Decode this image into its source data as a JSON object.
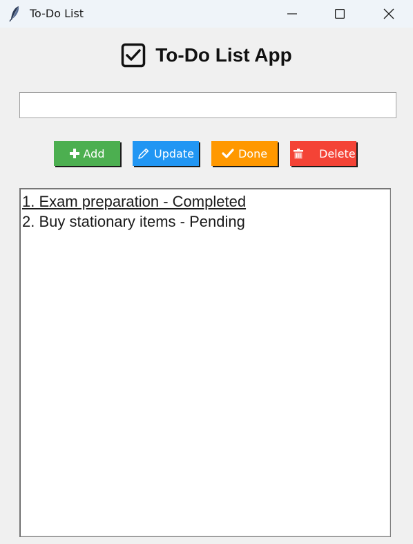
{
  "window": {
    "title": "To-Do List",
    "icon": "feather-icon",
    "controls": [
      "minimize-icon",
      "maximize-icon",
      "close-icon"
    ]
  },
  "header": {
    "icon": "checkbox-icon",
    "title": "To-Do List App"
  },
  "task_input": {
    "value": "",
    "placeholder": ""
  },
  "buttons": {
    "add": {
      "label": "Add",
      "icon": "plus-icon",
      "color": "#4caf50"
    },
    "update": {
      "label": "Update",
      "icon": "pencil-icon",
      "color": "#2196f3"
    },
    "done": {
      "label": "Done",
      "icon": "checkmark-icon",
      "color": "#ff9800"
    },
    "delete": {
      "label": "Delete",
      "icon": "trash-icon",
      "color": "#f44336"
    }
  },
  "tasks": [
    {
      "text": "1. Exam preparation - Completed",
      "active": true
    },
    {
      "text": "2. Buy stationary items - Pending",
      "active": false
    }
  ]
}
